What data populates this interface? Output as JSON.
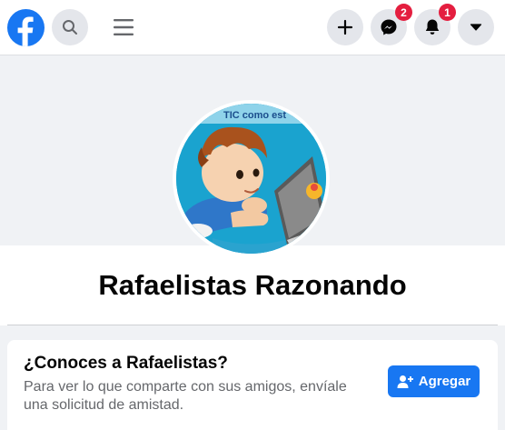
{
  "header": {
    "icons": [
      "facebook-logo",
      "search-icon",
      "menu-icon",
      "plus-icon",
      "messenger-icon",
      "bell-icon",
      "caret-down-icon"
    ],
    "messenger_badge": "2",
    "notifications_badge": "1"
  },
  "profile": {
    "name": "Rafaelistas Razonando",
    "avatar_caption": "TIC como est"
  },
  "friend_card": {
    "title": "¿Conoces a Rafaelistas?",
    "text": "Para ver lo que comparte con sus amigos, envíale una solicitud de amistad.",
    "button_label": "Agregar"
  },
  "colors": {
    "brand": "#1877f2",
    "badge": "#e41e3f",
    "background": "#f0f2f5"
  }
}
